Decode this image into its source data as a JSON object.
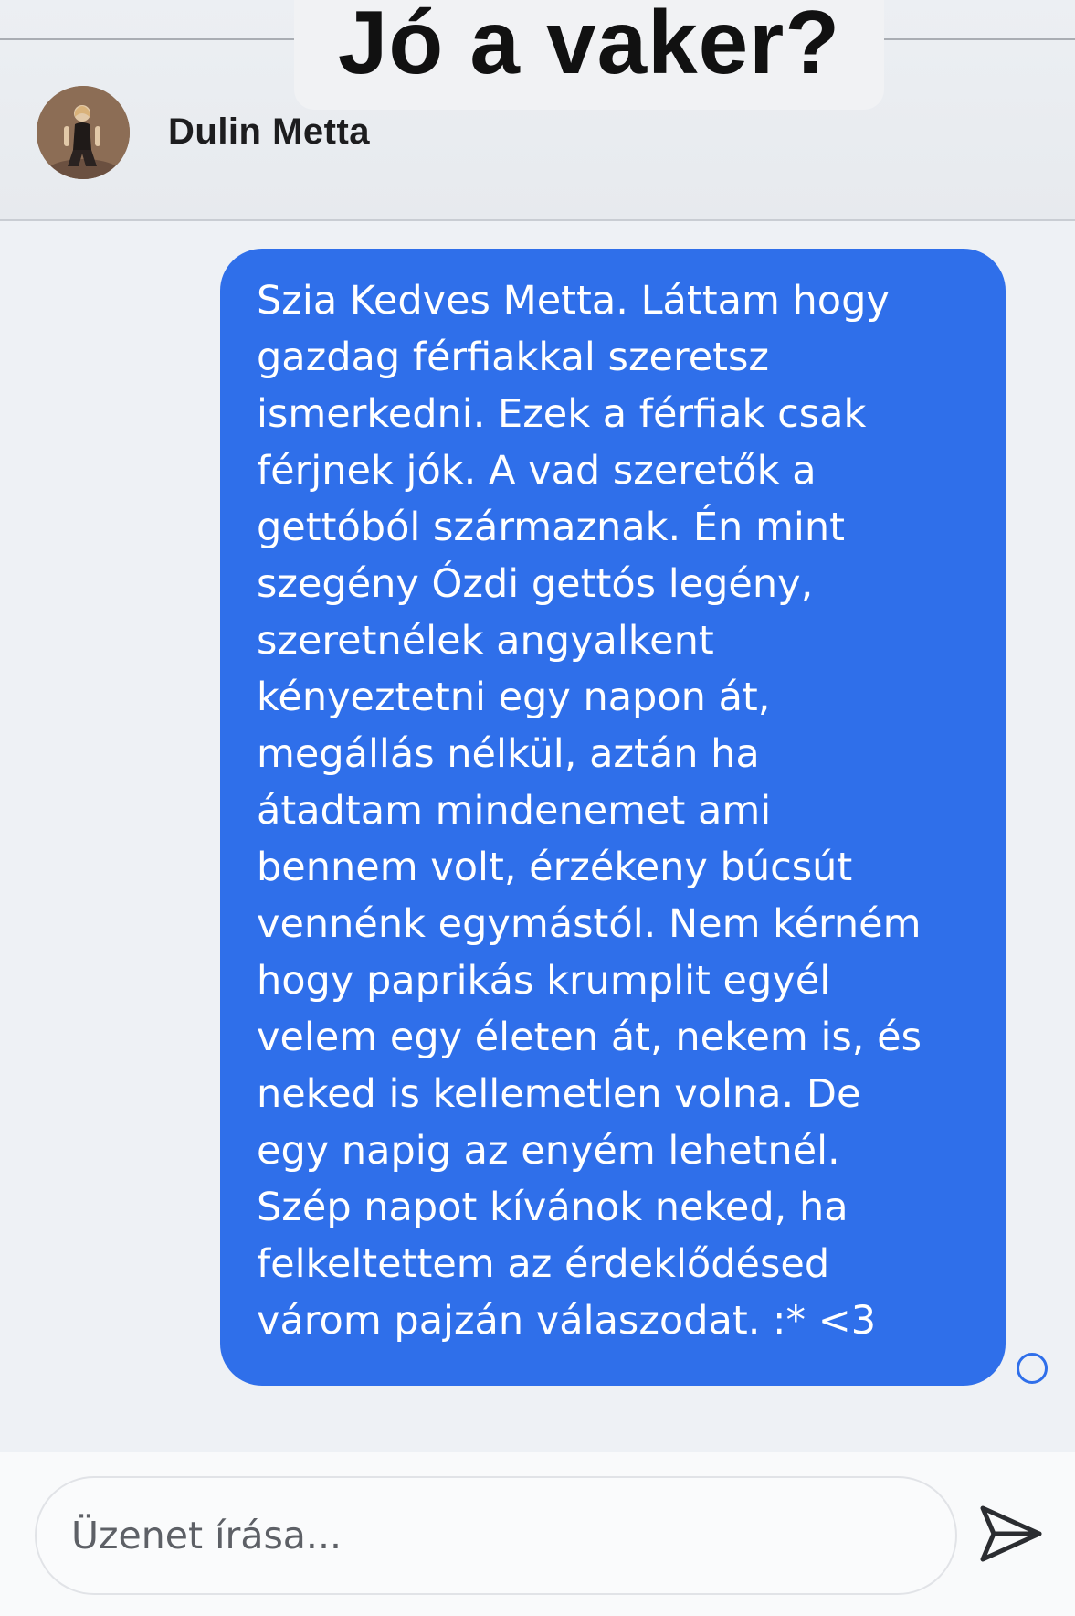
{
  "caption": "Jó a vaker?",
  "header": {
    "contact_name": "Dulin Metta",
    "avatar_icon": "contact-avatar"
  },
  "message": {
    "direction": "outgoing",
    "bubble_color": "#2f6fea",
    "text": "Szia Kedves Metta. Láttam hogy\ngazdag férfiakkal szeretsz\nismerkedni. Ezek a férfiak csak\nférjnek jók. A vad szeretők a\ngettóból származnak. Én mint\nszegény Ózdi gettós legény,\nszeretnélek angyalkent\nkényeztetni egy napon át,\nmegállás nélkül, aztán ha\nátadtam mindenemet ami\nbennem volt, érzékeny búcsút\nvennénk egymástól. Nem kérném\nhogy paprikás krumplit egyél\nvelem egy életen át, nekem is, és\nneked is kellemetlen volna. De\negy napig az enyém lehetnél.\nSzép napot kívánok neked, ha\nfelkeltettem az érdeklődésed\nvárom pajzán válaszodat. :* <3",
    "status_icon": "sent-status-circle-icon"
  },
  "composer": {
    "placeholder": "Üzenet írása...",
    "value": "",
    "send_icon": "send-icon"
  },
  "colors": {
    "accent": "#2f6fea",
    "background": "#eef1f5"
  }
}
